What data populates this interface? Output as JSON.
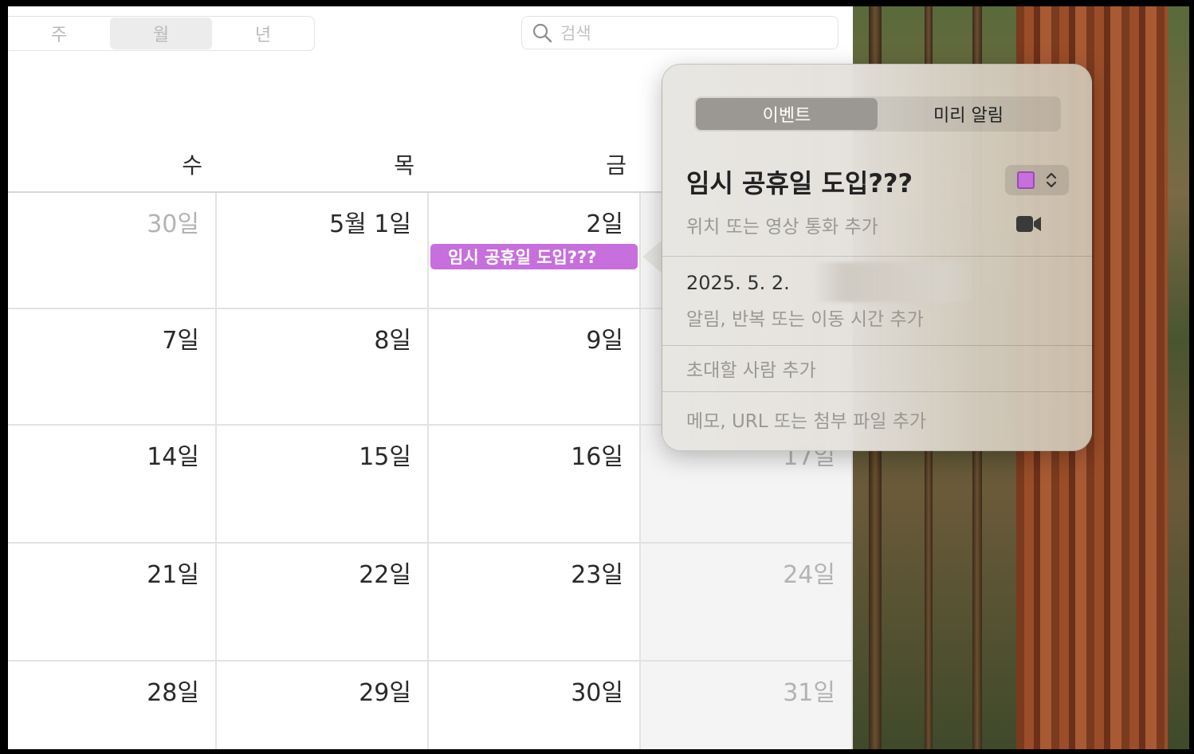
{
  "toolbar": {
    "view_tabs": [
      "주",
      "월",
      "년"
    ],
    "active_view": "월",
    "search_placeholder": "검색"
  },
  "calendar": {
    "weekdays": [
      "수",
      "목",
      "금"
    ],
    "weeks": [
      [
        "30일",
        "5월 1일",
        "2일",
        ""
      ],
      [
        "7일",
        "8일",
        "9일",
        ""
      ],
      [
        "14일",
        "15일",
        "16일",
        "17일"
      ],
      [
        "21일",
        "22일",
        "23일",
        "24일"
      ],
      [
        "28일",
        "29일",
        "30일",
        "31일"
      ]
    ],
    "event": {
      "title": "임시 공휴일 도입???",
      "color": "#c76fdc"
    }
  },
  "popover": {
    "tabs": [
      "이벤트",
      "미리 알림"
    ],
    "active_tab": "이벤트",
    "title": "임시 공휴일 도입???",
    "calendar_color": "#c76fdc",
    "location_placeholder": "위치 또는 영상 통화 추가",
    "date": "2025. 5. 2.",
    "alert_hint": "알림, 반복 또는 이동 시간 추가",
    "invitees_hint": "초대할 사람 추가",
    "notes_hint": "메모, URL 또는 첨부 파일 추가"
  }
}
